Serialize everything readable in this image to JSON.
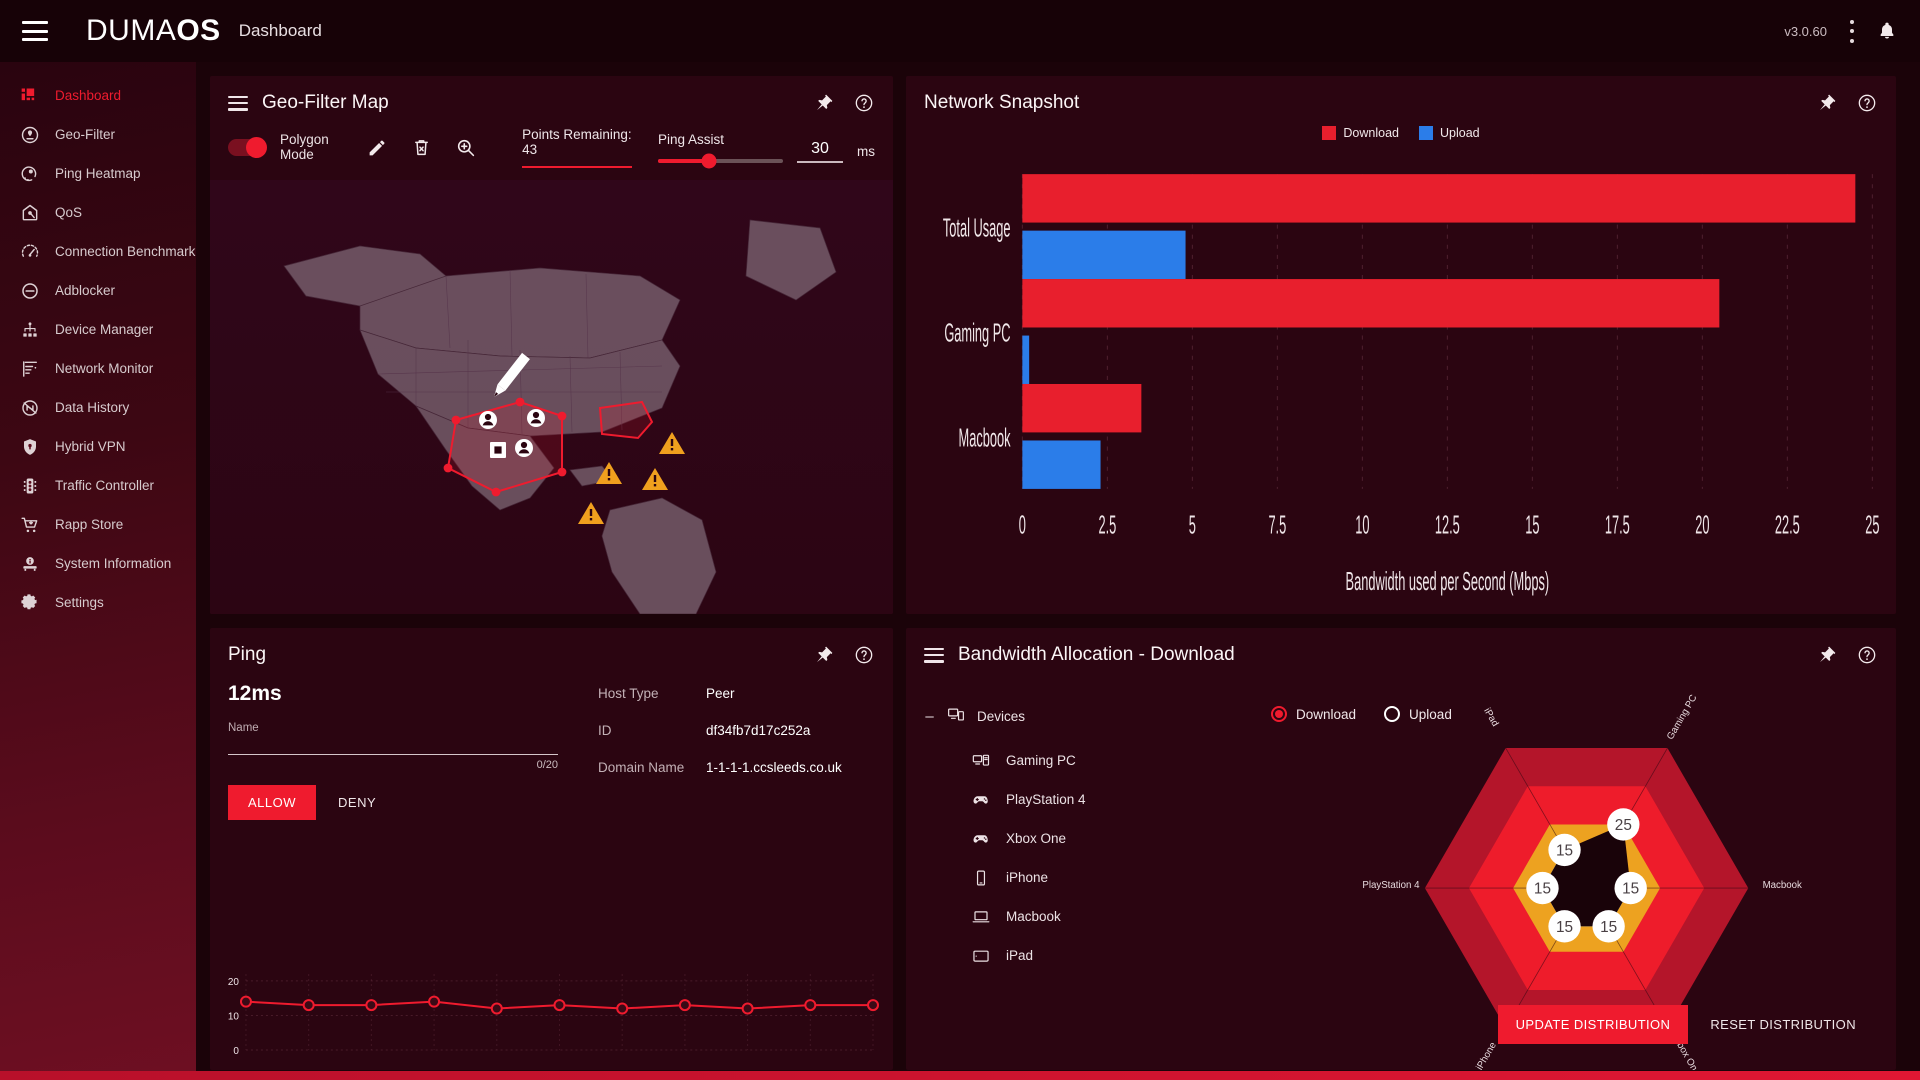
{
  "topbar": {
    "menu_icon": "hamburger-icon",
    "brand_light": "DUMA",
    "brand_bold": "OS",
    "page_title": "Dashboard",
    "version": "v3.0.60",
    "overflow_icon": "kebab-menu-icon",
    "bell_icon": "notification-bell-icon"
  },
  "sidebar": {
    "items": [
      {
        "label": "Dashboard",
        "icon": "dashboard-icon",
        "active": true
      },
      {
        "label": "Geo-Filter",
        "icon": "geofilter-icon",
        "active": false
      },
      {
        "label": "Ping Heatmap",
        "icon": "ping-heatmap-icon",
        "active": false
      },
      {
        "label": "QoS",
        "icon": "qos-icon",
        "active": false
      },
      {
        "label": "Connection Benchmark",
        "icon": "speedometer-icon",
        "active": false
      },
      {
        "label": "Adblocker",
        "icon": "block-icon",
        "active": false
      },
      {
        "label": "Device Manager",
        "icon": "device-tree-icon",
        "active": false
      },
      {
        "label": "Network Monitor",
        "icon": "monitor-list-icon",
        "active": false
      },
      {
        "label": "Data History",
        "icon": "data-history-icon",
        "active": false
      },
      {
        "label": "Hybrid VPN",
        "icon": "shield-lock-icon",
        "active": false
      },
      {
        "label": "Traffic Controller",
        "icon": "traffic-light-icon",
        "active": false
      },
      {
        "label": "Rapp Store",
        "icon": "shopping-cart-icon",
        "active": false
      },
      {
        "label": "System Information",
        "icon": "info-server-icon",
        "active": false
      },
      {
        "label": "Settings",
        "icon": "gear-icon",
        "active": false
      }
    ]
  },
  "geofilter": {
    "title": "Geo-Filter Map",
    "menu_icon": "hamburger-icon",
    "pin_icon": "pin-icon",
    "help_icon": "help-circle-icon",
    "polygon_mode_label": "Polygon Mode",
    "polygon_mode_on": true,
    "pencil_icon": "pencil-icon",
    "delete_icon": "trash-delete-icon",
    "zoom_icon": "magnifier-plus-icon",
    "points_remaining": "Points Remaining: 43",
    "ping_assist_label": "Ping Assist",
    "ping_assist_value": "30",
    "ping_assist_unit": "ms"
  },
  "ping": {
    "title": "Ping",
    "pin_icon": "pin-icon",
    "help_icon": "help-circle-icon",
    "latency": "12ms",
    "name_label": "Name",
    "name_value": "",
    "char_counter": "0/20",
    "allow_label": "ALLOW",
    "deny_label": "DENY",
    "host_type_label": "Host Type",
    "host_type_value": "Peer",
    "id_label": "ID",
    "id_value": "df34fb7d17c252a",
    "domain_label": "Domain Name",
    "domain_value": "1-1-1-1.ccsleeds.co.uk"
  },
  "snapshot": {
    "title": "Network Snapshot",
    "pin_icon": "pin-icon",
    "help_icon": "help-circle-icon"
  },
  "bandwidth": {
    "title": "Bandwidth Allocation - Download",
    "menu_icon": "hamburger-icon",
    "pin_icon": "pin-icon",
    "help_icon": "help-circle-icon",
    "devices_root_label": "Devices",
    "devices_root_icon": "devices-icon",
    "collapse_glyph": "–",
    "devices": [
      {
        "label": "Gaming PC",
        "icon": "desktop-pc-icon"
      },
      {
        "label": "PlayStation 4",
        "icon": "gamepad-icon"
      },
      {
        "label": "Xbox One",
        "icon": "gamepad-icon"
      },
      {
        "label": "iPhone",
        "icon": "phone-icon"
      },
      {
        "label": "Macbook",
        "icon": "laptop-icon"
      },
      {
        "label": "iPad",
        "icon": "tablet-icon"
      }
    ],
    "mode_download_label": "Download",
    "mode_upload_label": "Upload",
    "mode_selected": "Download",
    "update_label": "UPDATE DISTRIBUTION",
    "reset_label": "RESET DISTRIBUTION"
  },
  "colors": {
    "accent_red": "#ef1b2e",
    "download_red": "#e81f2d",
    "upload_blue": "#2b7de9",
    "radar_band_orange": "#eda220",
    "radar_band_blue": "#2b7de9",
    "panel_bg": "#2b0511",
    "page_bg": "#1b0309"
  },
  "chart_data": [
    {
      "type": "bar",
      "id": "network-snapshot",
      "title": "Network Snapshot",
      "orientation": "horizontal",
      "categories": [
        "Total Usage",
        "Gaming PC",
        "Macbook"
      ],
      "series": [
        {
          "name": "Download",
          "color": "#e81f2d",
          "values": [
            24.5,
            20.5,
            3.5
          ]
        },
        {
          "name": "Upload",
          "color": "#2b7de9",
          "values": [
            4.8,
            0.2,
            2.3
          ]
        }
      ],
      "xlabel": "Bandwidth used per Second (Mbps)",
      "ylabel": "",
      "xlim": [
        0,
        25
      ],
      "xticks": [
        "0",
        "2.5",
        "5",
        "7.5",
        "10",
        "12.5",
        "15",
        "17.5",
        "20",
        "22.5",
        "25"
      ],
      "grid": true,
      "legend": "top-center"
    },
    {
      "type": "line",
      "id": "ping-history",
      "title": "",
      "x": [
        1,
        2,
        3,
        4,
        5,
        6,
        7,
        8,
        9,
        10,
        11
      ],
      "values": [
        14,
        13,
        13,
        14,
        12,
        13,
        12,
        13,
        12,
        13,
        13
      ],
      "color": "#ef1b2e",
      "yticks": [
        "0",
        "10",
        "20"
      ],
      "ylim": [
        0,
        22
      ],
      "grid": true,
      "markers": true
    },
    {
      "type": "radar",
      "id": "bandwidth-distribution",
      "title": "Bandwidth Allocation - Download",
      "categories": [
        "Gaming PC",
        "Macbook",
        "Xbox One",
        "iPhone",
        "PlayStation 4",
        "iPad"
      ],
      "values": [
        25,
        15,
        15,
        15,
        15,
        15
      ],
      "value_labels": [
        "25",
        "15",
        "15",
        "15",
        "15",
        "15"
      ],
      "bands": [
        {
          "level": 15,
          "color": "#2b7de9"
        },
        {
          "level": 25,
          "color": "#eda220"
        },
        {
          "level": 40,
          "color": "#ee1c2b"
        },
        {
          "level": 55,
          "color": "#b4152a"
        }
      ],
      "max": 55
    }
  ]
}
